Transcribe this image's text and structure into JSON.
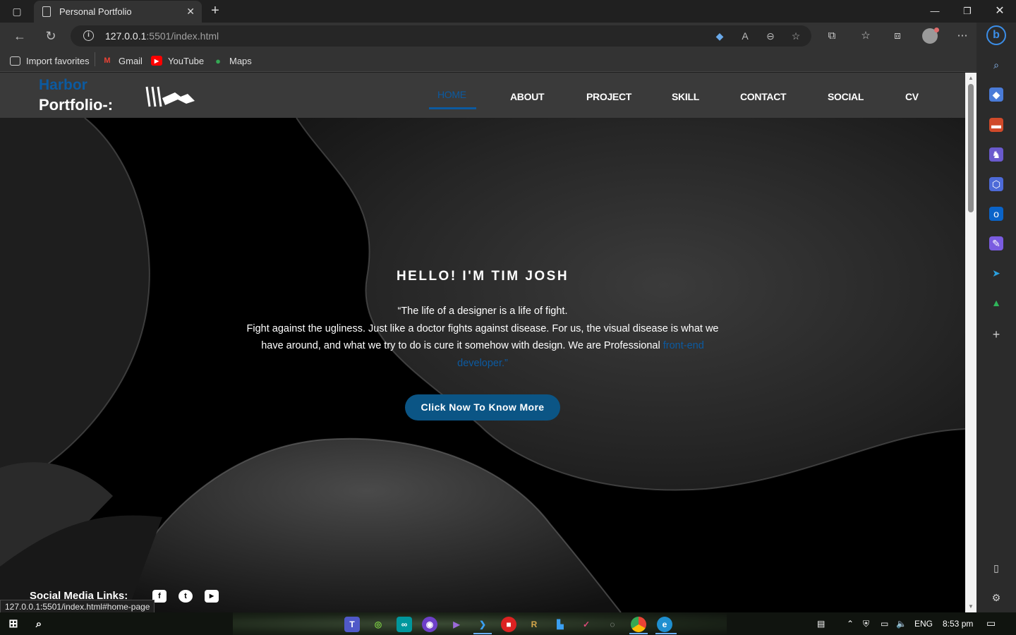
{
  "browser": {
    "tab_title": "Personal Portfolio",
    "url_host": "127.0.0.1",
    "url_rest": ":5501/index.html",
    "favorites": [
      {
        "label": "Import favorites",
        "icon": "import-icon"
      },
      {
        "label": "Gmail",
        "icon": "gmail-icon"
      },
      {
        "label": "YouTube",
        "icon": "youtube-icon"
      },
      {
        "label": "Maps",
        "icon": "maps-icon"
      }
    ],
    "status_url": "127.0.0.1:5501/index.html#home-page"
  },
  "site": {
    "brand_top": "Harbor",
    "brand_bottom": "Portfolio-:",
    "nav": [
      "HOME",
      "ABOUT",
      "PROJECT",
      "SKILL",
      "CONTACT",
      "SOCIAL",
      "CV"
    ],
    "active_nav": "HOME",
    "accent_color": "#0c5aa0",
    "hero": {
      "title": "HELLO! I'M TIM JOSH",
      "line1": "“The life of a designer is a life of fight.",
      "line2": "Fight against the ugliness. Just like a doctor fights against disease. For us, the visual disease is what we have around, and what we try to do is cure it somehow with design. We are Professional ",
      "accent_text": "front-end developer.”",
      "cta_label": "Click Now To Know More"
    },
    "social_label": "Social Media Links:",
    "social_icons": [
      "facebook-icon",
      "twitter-icon",
      "youtube-icon"
    ]
  },
  "taskbar": {
    "language": "ENG",
    "time": "8:53 pm"
  }
}
